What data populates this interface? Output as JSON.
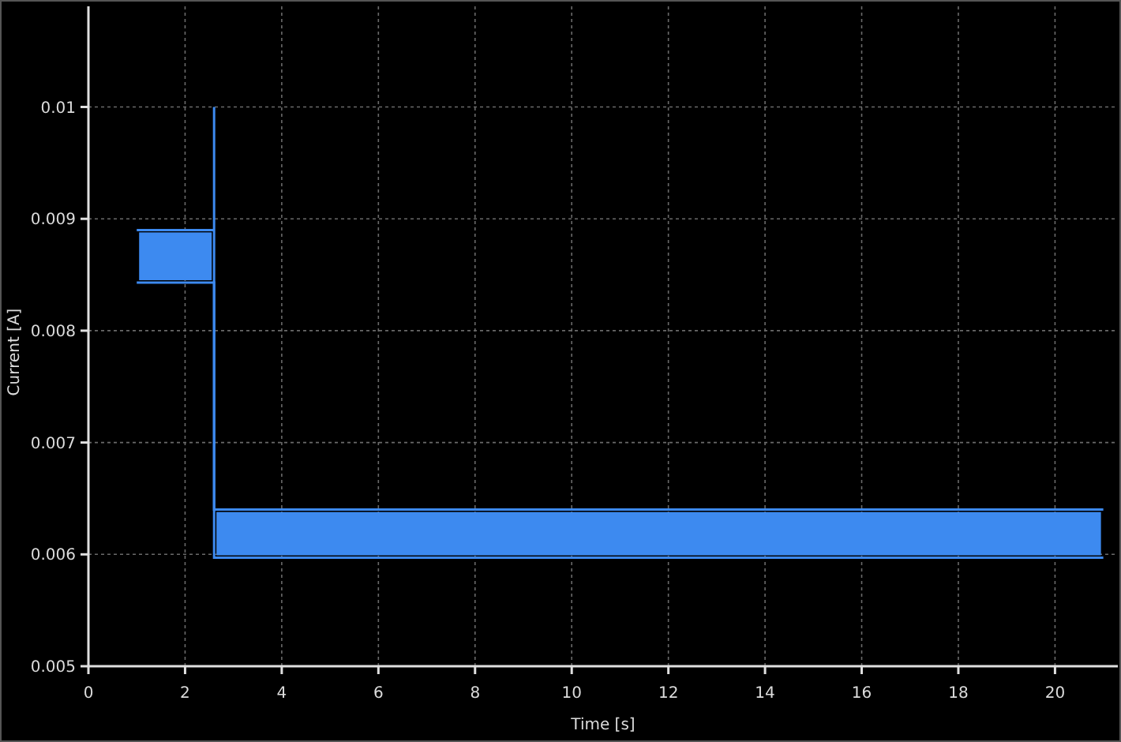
{
  "chart_data": {
    "type": "line",
    "grid": true,
    "xlabel": "Time [s]",
    "ylabel": "Current [A]",
    "x": [
      1,
      2.6,
      2.6,
      2.6,
      21
    ],
    "xlim": [
      0,
      21.3
    ],
    "ylim": [
      0.005,
      0.0109
    ],
    "xticks": [
      0,
      2,
      4,
      6,
      8,
      10,
      12,
      14,
      16,
      18,
      20
    ],
    "yticks": [
      {
        "value": 0.005,
        "label": "0.005"
      },
      {
        "value": 0.006,
        "label": "0.006"
      },
      {
        "value": 0.007,
        "label": "0.007"
      },
      {
        "value": 0.008,
        "label": "0.008"
      },
      {
        "value": 0.009,
        "label": "0.009"
      },
      {
        "value": 0.01,
        "label": "0.01"
      }
    ],
    "series": [
      {
        "color": "#3d8af0",
        "values": [
          0.0089,
          0.0089,
          0.01,
          0.0064,
          0.0064
        ]
      },
      {
        "color": "#3d8af0",
        "values": [
          0.00843,
          0.00843,
          0.00843,
          0.00597,
          0.00597
        ]
      }
    ]
  }
}
